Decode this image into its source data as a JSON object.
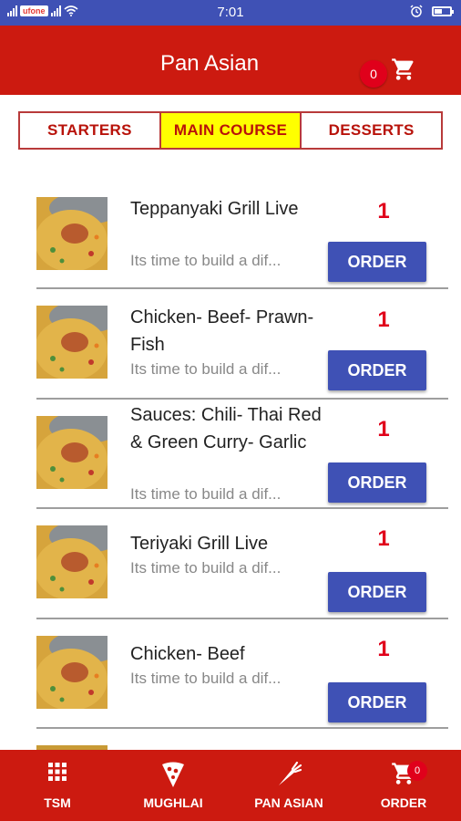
{
  "status_bar": {
    "carrier": "ufone",
    "time": "7:01"
  },
  "app_bar": {
    "title": "Pan Asian",
    "cart_count": "0"
  },
  "tabs": [
    {
      "label": "STARTERS",
      "active": false
    },
    {
      "label": "MAIN COURSE",
      "active": true
    },
    {
      "label": "DESSERTS",
      "active": false
    }
  ],
  "items": [
    {
      "name": "Teppanyaki Grill Live",
      "description": "Its time to build a dif...",
      "quantity": "1",
      "button_label": "ORDER"
    },
    {
      "name": "Chicken- Beef- Prawn- Fish",
      "description": "Its time to build a dif...",
      "quantity": "1",
      "button_label": "ORDER"
    },
    {
      "name": "Sauces: Chili- Thai Red & Green Curry- Garlic",
      "description": "Its time to build a dif...",
      "quantity": "1",
      "button_label": "ORDER"
    },
    {
      "name": "Teriyaki Grill Live",
      "description": "Its time to build a dif...",
      "quantity": "1",
      "button_label": "ORDER"
    },
    {
      "name": "Chicken- Beef",
      "description": "Its time to build a dif...",
      "quantity": "1",
      "button_label": "ORDER"
    }
  ],
  "bottom_nav": [
    {
      "label": "TSM",
      "icon": "grid-icon"
    },
    {
      "label": "MUGHLAI",
      "icon": "pizza-icon"
    },
    {
      "label": "PAN ASIAN",
      "icon": "carrot-icon"
    },
    {
      "label": "ORDER",
      "icon": "cart-icon",
      "badge": "0"
    }
  ],
  "colors": {
    "primary": "#cc1a10",
    "status_bar": "#3f51b5",
    "button": "#3f51b5",
    "active_tab": "#ffff00",
    "quantity": "#e0001b"
  }
}
